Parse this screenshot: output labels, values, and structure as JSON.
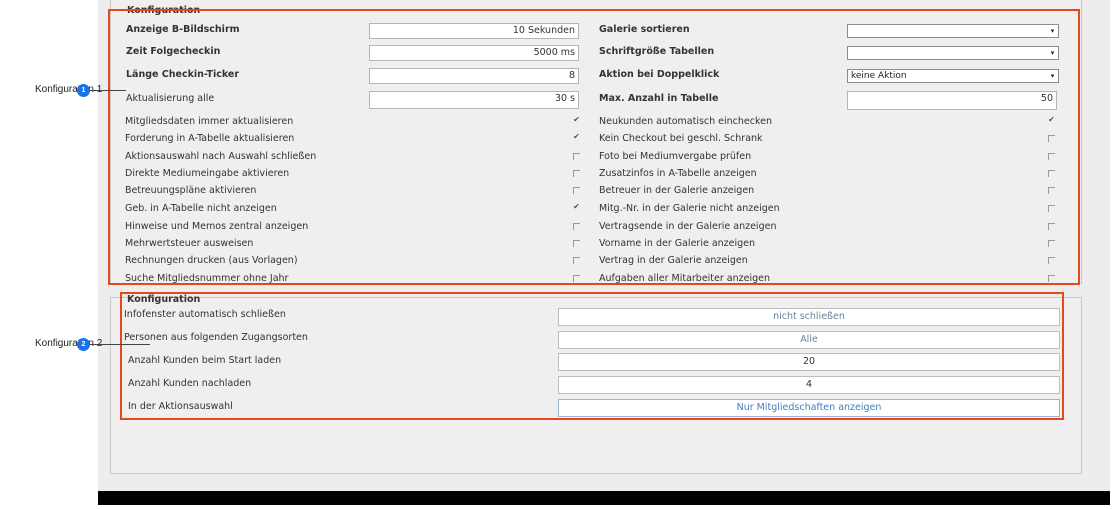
{
  "callouts": {
    "c1": {
      "label": "Konfiguration 1",
      "number": "1"
    },
    "c2": {
      "label": "Konfiguration 2",
      "number": "2"
    }
  },
  "section1": {
    "legend": "Konfiguration",
    "left_fields": [
      {
        "label": "Anzeige B-Bildschirm",
        "value": "10 Sekunden"
      },
      {
        "label": "Zeit Folgecheckin",
        "value": "5000 ms"
      },
      {
        "label": "Länge Checkin-Ticker",
        "value": "8"
      },
      {
        "label": "Aktualisierung alle",
        "value": "30 s"
      }
    ],
    "right_fields": [
      {
        "label": "Galerie sortieren",
        "value": ""
      },
      {
        "label": "Schriftgröße Tabellen",
        "value": ""
      },
      {
        "label": "Aktion bei Doppelklick",
        "value": "keine Aktion"
      },
      {
        "label": "Max. Anzahl in Tabelle",
        "value": "50"
      }
    ],
    "left_checks": [
      {
        "label": "Mitgliedsdaten immer aktualisieren",
        "checked": true
      },
      {
        "label": "Forderung in A-Tabelle aktualisieren",
        "checked": true
      },
      {
        "label": "Aktionsauswahl nach Auswahl schließen",
        "checked": false
      },
      {
        "label": "Direkte Mediumeingabe aktivieren",
        "checked": false
      },
      {
        "label": "Betreuungspläne aktivieren",
        "checked": false
      },
      {
        "label": "Geb. in A-Tabelle nicht anzeigen",
        "checked": true
      },
      {
        "label": "Hinweise und Memos zentral anzeigen",
        "checked": false
      },
      {
        "label": "Mehrwertsteuer ausweisen",
        "checked": false
      },
      {
        "label": "Rechnungen drucken (aus Vorlagen)",
        "checked": false
      },
      {
        "label": "Suche Mitgliedsnummer ohne Jahr",
        "checked": false
      }
    ],
    "right_checks": [
      {
        "label": "Neukunden automatisch einchecken",
        "checked": true
      },
      {
        "label": "Kein Checkout bei geschl. Schrank",
        "checked": false
      },
      {
        "label": "Foto bei Mediumvergabe prüfen",
        "checked": false
      },
      {
        "label": "Zusatzinfos in A-Tabelle anzeigen",
        "checked": false
      },
      {
        "label": "Betreuer in der Galerie anzeigen",
        "checked": false
      },
      {
        "label": "Mitg.-Nr. in der Galerie nicht anzeigen",
        "checked": false
      },
      {
        "label": "Vertragsende in der Galerie anzeigen",
        "checked": false
      },
      {
        "label": "Vorname in der Galerie anzeigen",
        "checked": false
      },
      {
        "label": "Vertrag in der Galerie anzeigen",
        "checked": false
      },
      {
        "label": "Aufgaben aller Mitarbeiter anzeigen",
        "checked": false
      }
    ]
  },
  "section2": {
    "legend": "Konfiguration",
    "rows": [
      {
        "label": "Infofenster automatisch schließen",
        "value": "nicht schließen"
      },
      {
        "label": "Personen aus folgenden Zugangsorten",
        "value": "Alle"
      },
      {
        "label": "Anzahl Kunden beim Start laden",
        "value": "20"
      },
      {
        "label": "Anzahl Kunden nachladen",
        "value": "4"
      },
      {
        "label": "In der Aktionsauswahl",
        "value": "Nur Mitgliedschaften anzeigen"
      }
    ]
  },
  "colors": {
    "highlight": "#e8461f",
    "badge": "#1a73e8"
  },
  "icons": {
    "checked": "checkmark-icon",
    "dropdown": "chevron-down-icon"
  }
}
